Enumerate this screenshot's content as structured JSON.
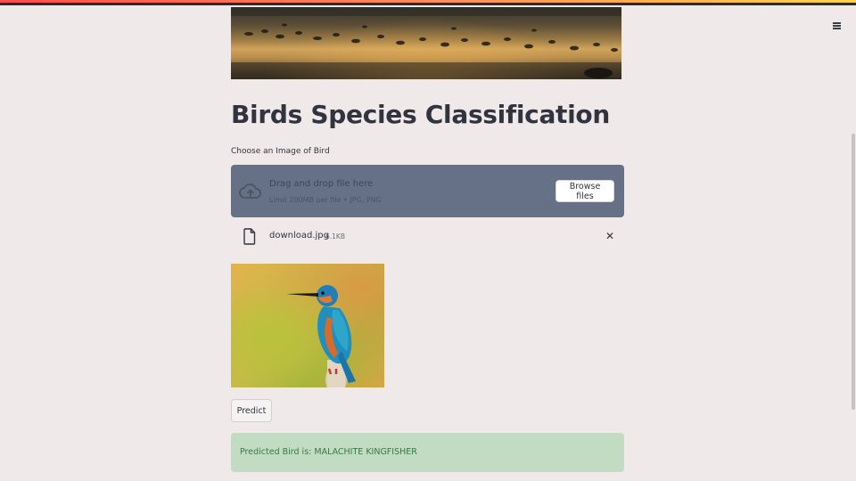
{
  "header": {
    "menu_icon": "hamburger-menu-icon"
  },
  "main": {
    "title": "Birds Species Classification",
    "upload_label": "Choose an Image of Bird"
  },
  "uploader": {
    "icon": "cloud-upload-icon",
    "drop_title": "Drag and drop file here",
    "drop_subtitle": "Limit 200MB per file • JPG, PNG",
    "browse_label": "Browse files"
  },
  "file": {
    "icon": "file-icon",
    "name": "download.jpg",
    "size": "6.1KB",
    "remove_icon": "close-icon",
    "remove_label": "✕"
  },
  "actions": {
    "predict_label": "Predict"
  },
  "result": {
    "text": "Predicted Bird is: MALACHITE KINGFISHER"
  },
  "colors": {
    "background": "#efe9e9",
    "dropzone": "#667187",
    "success_bg": "#c2dcc4",
    "success_text": "#2f7d45",
    "text": "#31333f"
  }
}
